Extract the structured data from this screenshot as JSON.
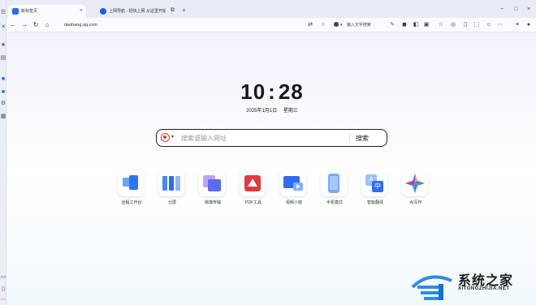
{
  "tabs": [
    {
      "label": "新标签页",
      "active": true,
      "icon": "new-tab-icon"
    },
    {
      "label": "上网导航 - 轻快上网 从这里开始",
      "active": false,
      "icon": "qq-browser-icon"
    }
  ],
  "tabbar": {
    "close": "×",
    "new_tab": "+"
  },
  "window": {
    "minimize": "−",
    "maximize": "□",
    "close": "×"
  },
  "nav": {
    "back": "←",
    "forward": "→",
    "refresh": "↻",
    "home": "⌂",
    "url": "daohang.qq.com",
    "search_pill": "输入文字搜索"
  },
  "clock": {
    "hour": "10",
    "minute": "28",
    "date": "2025年1月1日",
    "weekday": "星期三"
  },
  "search": {
    "placeholder": "搜索或输入网址",
    "button": "搜索",
    "engine": "sogou"
  },
  "tiles": [
    {
      "label": "远程工作台",
      "icon": "remote-workstation-icon"
    },
    {
      "label": "分屏",
      "icon": "split-screen-icon"
    },
    {
      "label": "跨端传输",
      "icon": "cross-device-transfer-icon"
    },
    {
      "label": "PDF工具",
      "icon": "pdf-tool-icon"
    },
    {
      "label": "视频小窗",
      "icon": "video-mini-window-icon"
    },
    {
      "label": "手机模式",
      "icon": "phone-mode-icon"
    },
    {
      "label": "智能翻译",
      "icon": "smart-translate-icon"
    },
    {
      "label": "AI写作",
      "icon": "ai-writing-icon"
    }
  ],
  "watermark": {
    "title": "系统之家",
    "subtitle": "XITONGZHIJIA.NET"
  },
  "colors": {
    "accent": "#2a6af5",
    "search_border": "#1d1d1d",
    "pdf_red": "#e5383b",
    "sogou_red": "#e53a2b"
  }
}
